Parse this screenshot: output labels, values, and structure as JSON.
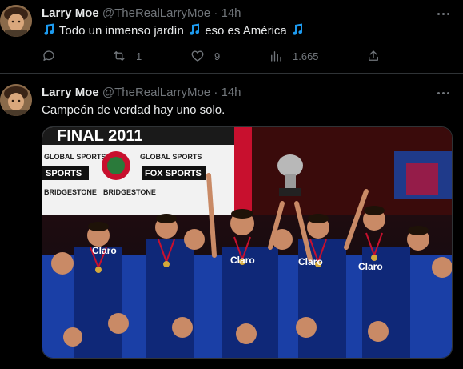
{
  "tweets": [
    {
      "author": "Larry Moe",
      "handle": "@TheRealLarryMoe",
      "separator": "·",
      "time": "14h",
      "text_part1": "Todo un inmenso jardín",
      "text_part2": "eso es América",
      "replies": "",
      "retweets": "1",
      "likes": "9",
      "views": "1.665"
    },
    {
      "author": "Larry Moe",
      "handle": "@TheRealLarryMoe",
      "separator": "·",
      "time": "14h",
      "text": "Campeón de verdad hay uno solo.",
      "photo": {
        "banner_title": "FINAL 2011",
        "sponsor_1": "GLOBAL SPORTS",
        "sponsor_2": "FOX SPORTS",
        "sponsor_3": "BRIDGESTONE",
        "sponsor_fox": "FOX",
        "sponsor_sports": "SPORTS",
        "jersey_brand": "Claro"
      }
    }
  ],
  "colors": {
    "background": "#000000",
    "text": "#e7e9ea",
    "muted": "#71767b",
    "note": "#1d9bf0",
    "divider": "#2f3336"
  },
  "icons": [
    "music-note-icon",
    "reply-icon",
    "retweet-icon",
    "like-icon",
    "views-icon",
    "share-icon",
    "more-icon"
  ]
}
